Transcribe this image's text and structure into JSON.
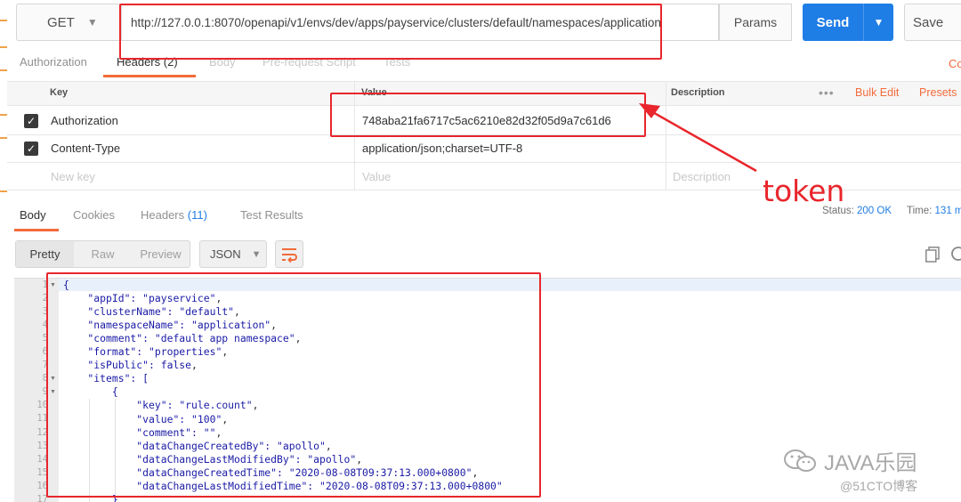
{
  "request": {
    "method": "GET",
    "url": "http://127.0.0.1:8070/openapi/v1/envs/dev/apps/payservice/clusters/default/namespaces/application",
    "params_label": "Params",
    "send_label": "Send",
    "save_label": "Save"
  },
  "request_tabs": [
    {
      "label": "Authorization"
    },
    {
      "label": "Headers",
      "count": "(2)"
    },
    {
      "label": "Body"
    },
    {
      "label": "Pre-request Script"
    },
    {
      "label": "Tests"
    }
  ],
  "request_tabs_cut": "Co",
  "headers_table": {
    "columns": {
      "key": "Key",
      "value": "Value",
      "description": "Description"
    },
    "menu_icon": "more-dots-icon",
    "bulk_edit_label": "Bulk Edit",
    "presets_label": "Presets",
    "rows": [
      {
        "checked": true,
        "key": "Authorization",
        "value": "748aba21fa6717c5ac6210e82d32f05d9a7c61d6"
      },
      {
        "checked": true,
        "key": "Content-Type",
        "value": "application/json;charset=UTF-8"
      }
    ],
    "placeholders": {
      "key": "New key",
      "value": "Value",
      "description": "Description"
    }
  },
  "response_tabs": [
    {
      "label": "Body"
    },
    {
      "label": "Cookies"
    },
    {
      "label": "Headers",
      "count": "(11)"
    },
    {
      "label": "Test Results"
    }
  ],
  "status": {
    "status_label": "Status:",
    "status_value": "200 OK",
    "time_label": "Time:",
    "time_value": "131 m"
  },
  "view_modes": [
    "Pretty",
    "Raw",
    "Preview"
  ],
  "format": "JSON",
  "code": {
    "line_numbers": [
      "1",
      "2",
      "3",
      "4",
      "5",
      "6",
      "7",
      "8",
      "9",
      "10",
      "11",
      "12",
      "13",
      "14",
      "15",
      "16",
      "17"
    ],
    "lines": [
      [
        "{"
      ],
      [
        "    \"appId\": ",
        "\"payservice\"",
        ","
      ],
      [
        "    \"clusterName\": ",
        "\"default\"",
        ","
      ],
      [
        "    \"namespaceName\": ",
        "\"application\"",
        ","
      ],
      [
        "    \"comment\": ",
        "\"default app namespace\"",
        ","
      ],
      [
        "    \"format\": ",
        "\"properties\"",
        ","
      ],
      [
        "    \"isPublic\": ",
        "false",
        ","
      ],
      [
        "    \"items\": ",
        "[",
        ""
      ],
      [
        "        {"
      ],
      [
        "            \"key\": ",
        "\"rule.count\"",
        ","
      ],
      [
        "            \"value\": ",
        "\"100\"",
        ","
      ],
      [
        "            \"comment\": ",
        "\"\"",
        ","
      ],
      [
        "            \"dataChangeCreatedBy\": ",
        "\"apollo\"",
        ","
      ],
      [
        "            \"dataChangeLastModifiedBy\": ",
        "\"apollo\"",
        ","
      ],
      [
        "            \"dataChangeCreatedTime\": ",
        "\"2020-08-08T09:37:13.000+0800\"",
        ","
      ],
      [
        "            \"dataChangeLastModifiedTime\": ",
        "\"2020-08-08T09:37:13.000+0800\"",
        ""
      ],
      [
        "        }"
      ]
    ]
  },
  "annotation": {
    "label": "token",
    "color": "#e8262c"
  },
  "watermarks": {
    "brand": "JAVA乐园",
    "source": "@51CTO博客"
  },
  "colors": {
    "accent": "#f26b3a",
    "send": "#1f7de6",
    "link": "#1f7de6"
  }
}
